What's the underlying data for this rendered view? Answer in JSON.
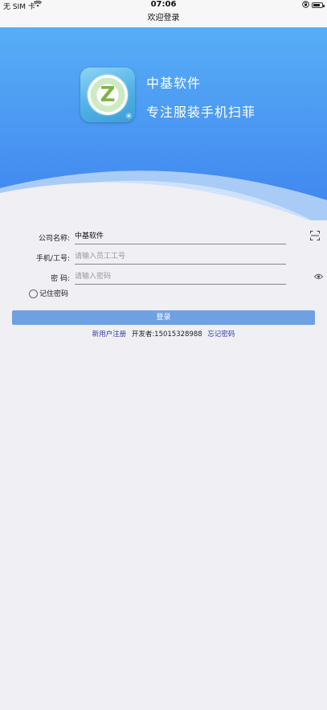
{
  "status_bar": {
    "carrier": "无 SIM 卡",
    "time": "07:06"
  },
  "nav": {
    "title": "欢迎登录"
  },
  "hero": {
    "brand_name": "中基软件",
    "slogan": "专注服装手机扫菲",
    "logo_letter": "Z",
    "colors": {
      "top": "#55adf5",
      "bottom": "#3f86f0"
    }
  },
  "form": {
    "company": {
      "label": "公司名称:",
      "value": "中基软件"
    },
    "user": {
      "label": "手机/工号:",
      "placeholder": "请输入员工工号"
    },
    "password": {
      "label": "密 码:",
      "placeholder": "请输入密码"
    },
    "remember_label": "记住密码",
    "login_label": "登录"
  },
  "links": {
    "register": "新用户注册",
    "developer": "开发者:15015328988",
    "forgot": "忘记密码"
  },
  "icons": {
    "scan": "scan-icon",
    "eye": "eye-icon"
  }
}
